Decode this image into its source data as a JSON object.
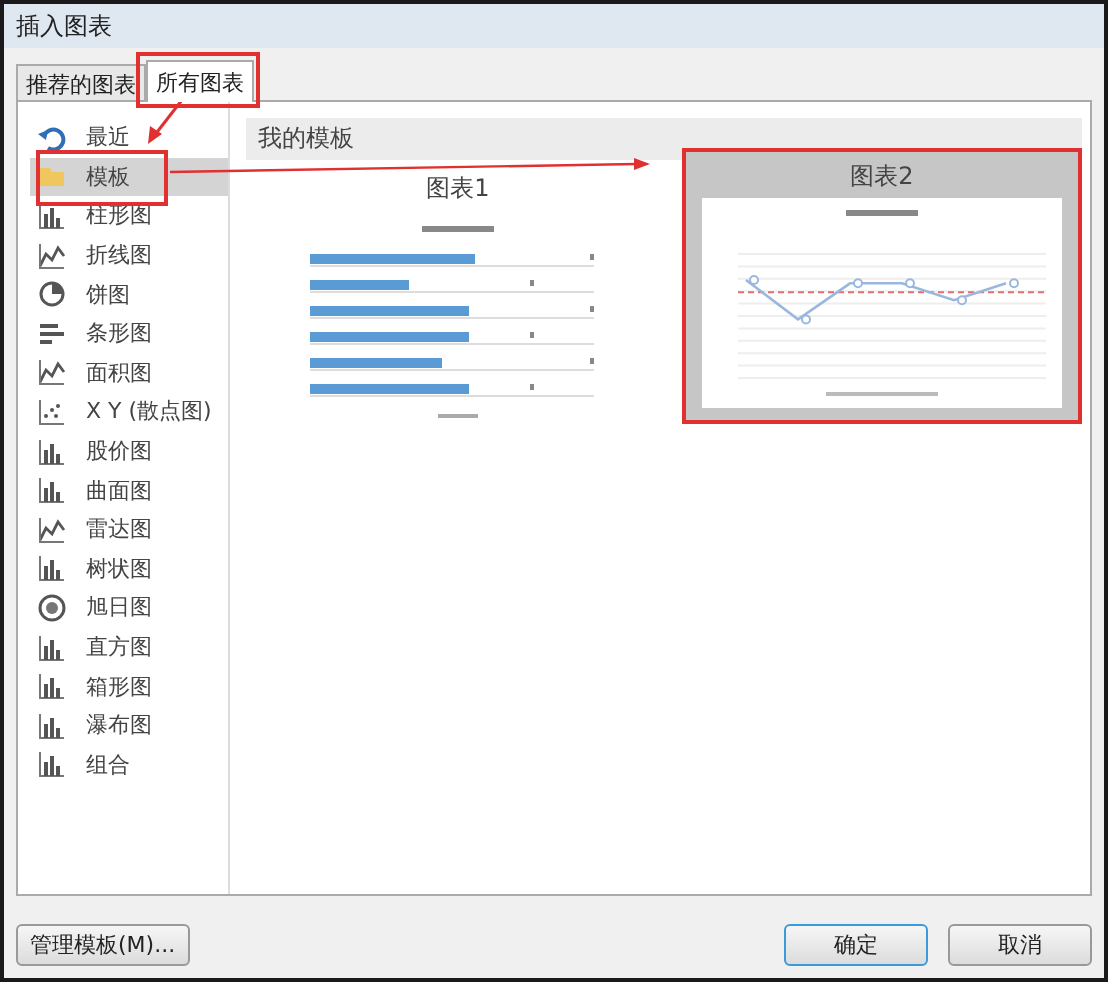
{
  "window": {
    "title": "插入图表"
  },
  "tabs": [
    {
      "label": "推荐的图表",
      "selected": false
    },
    {
      "label": "所有图表",
      "selected": true
    }
  ],
  "sidebar": {
    "items": [
      {
        "label": "最近",
        "selected": false
      },
      {
        "label": "模板",
        "selected": true
      },
      {
        "label": "柱形图",
        "selected": false
      },
      {
        "label": "折线图",
        "selected": false
      },
      {
        "label": "饼图",
        "selected": false
      },
      {
        "label": "条形图",
        "selected": false
      },
      {
        "label": "面积图",
        "selected": false
      },
      {
        "label": "X Y (散点图)",
        "selected": false
      },
      {
        "label": "股价图",
        "selected": false
      },
      {
        "label": "曲面图",
        "selected": false
      },
      {
        "label": "雷达图",
        "selected": false
      },
      {
        "label": "树状图",
        "selected": false
      },
      {
        "label": "旭日图",
        "selected": false
      },
      {
        "label": "直方图",
        "selected": false
      },
      {
        "label": "箱形图",
        "selected": false
      },
      {
        "label": "瀑布图",
        "selected": false
      },
      {
        "label": "组合",
        "selected": false
      }
    ]
  },
  "section_title": "我的模板",
  "templates": [
    {
      "label": "图表1",
      "kind": "bar",
      "selected": false
    },
    {
      "label": "图表2",
      "kind": "line",
      "selected": true
    }
  ],
  "buttons": {
    "manage": "管理模板(M)...",
    "ok": "确定",
    "cancel": "取消"
  }
}
